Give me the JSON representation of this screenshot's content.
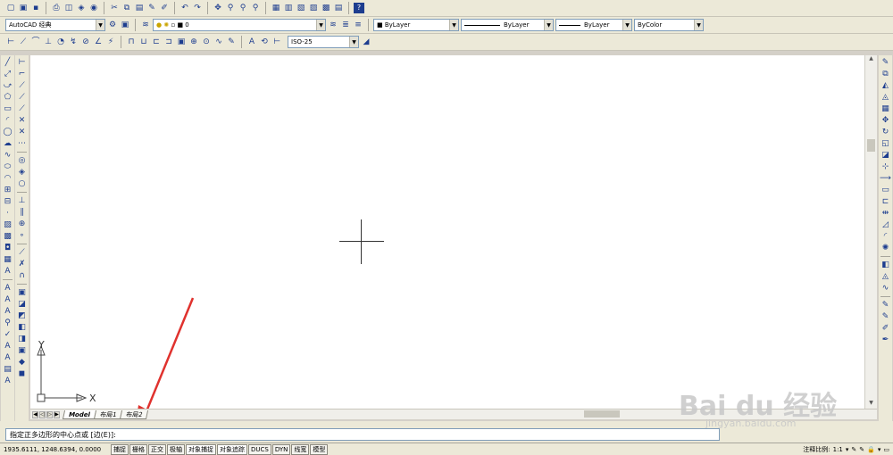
{
  "toolbars": {
    "workspace": "AutoCAD 经典",
    "layer": "0",
    "color": "ByLayer",
    "linetype": "ByLayer",
    "lineweight": "ByLayer",
    "plotstyle": "ByColor",
    "dimstyle": "ISO-25"
  },
  "canvas": {
    "ucs_y": "Y",
    "ucs_x": "X"
  },
  "layout_tabs": [
    "Model",
    "布局1",
    "布局2"
  ],
  "command": {
    "prompt": "指定正多边形的中心点或 [边(E)]:"
  },
  "status": {
    "coordinates": "1935.6111, 1248.6394, 0.0000",
    "buttons": [
      "捕捉",
      "栅格",
      "正交",
      "极轴",
      "对象捕捉",
      "对象追踪",
      "DUCS",
      "DYN",
      "线宽",
      "模型"
    ],
    "annotation_scale_label": "注释比例:",
    "annotation_scale_value": "1:1"
  },
  "watermark": {
    "logo": "Bai du 经验",
    "url": "jingyan.baidu.com"
  },
  "colors": {
    "accent": "#e0322e",
    "canvas": "#ffffff"
  },
  "icons": {
    "left_draw": [
      "line-icon",
      "xline-icon",
      "pline-icon",
      "polygon-icon",
      "rectangle-icon",
      "arc-icon",
      "circle-icon",
      "cloud-icon",
      "spline-icon",
      "ellipse-icon",
      "ellipse-arc-icon",
      "insert-icon",
      "block-icon",
      "point-icon",
      "hatch-icon",
      "gradient-icon",
      "region-icon",
      "table-icon",
      "mtext-icon"
    ],
    "right_modify": [
      "erase-icon",
      "copy-icon",
      "mirror-icon",
      "offset-icon",
      "array-icon",
      "move-icon",
      "rotate-icon",
      "scale-icon",
      "stretch-icon",
      "trim-icon",
      "extend-icon",
      "break-icon",
      "join-icon",
      "chamfer-icon",
      "fillet-icon",
      "explode-icon"
    ]
  }
}
